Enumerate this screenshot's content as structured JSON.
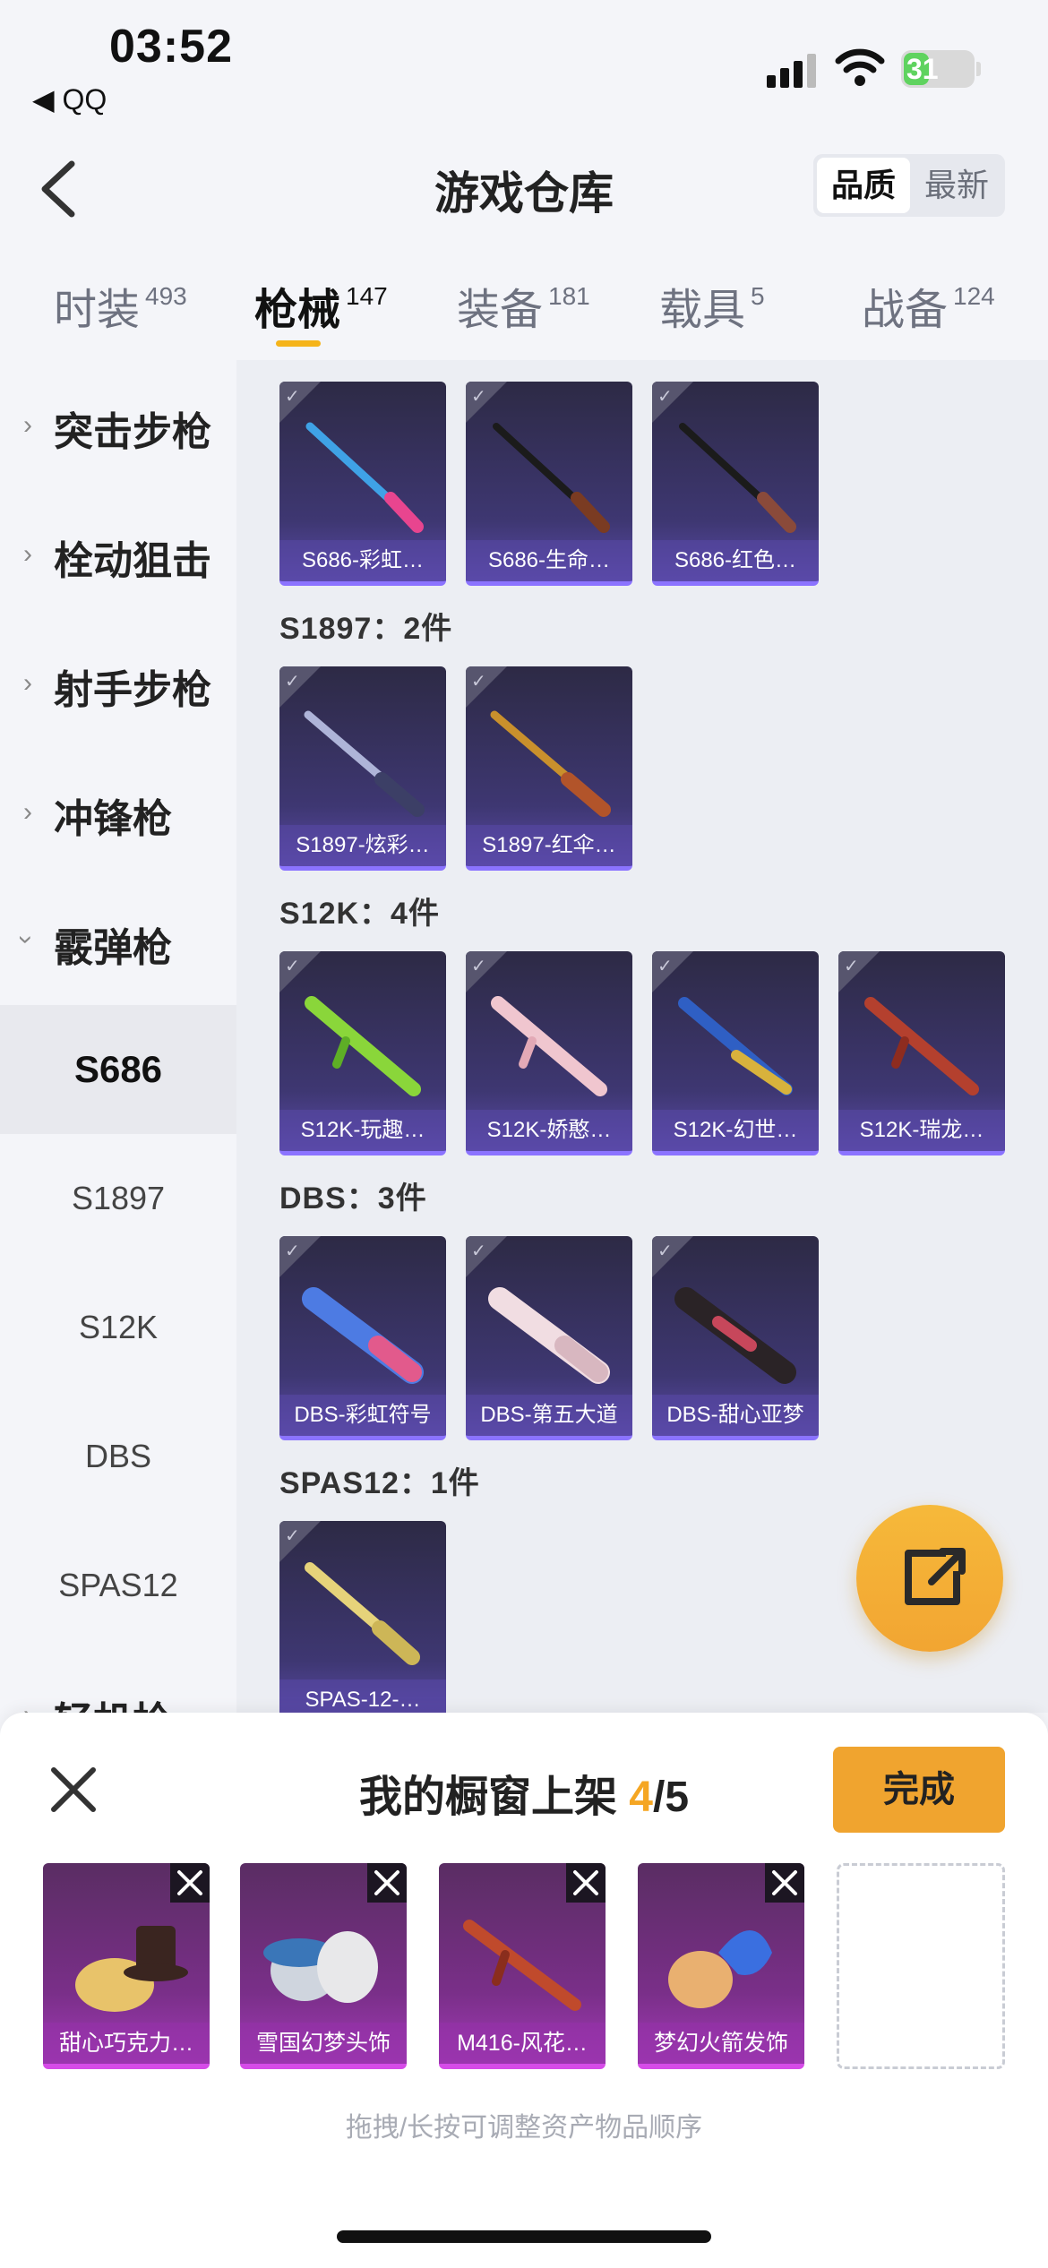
{
  "status_bar": {
    "time": "03:52",
    "back_app": "◀ QQ",
    "battery": "31"
  },
  "header": {
    "title": "游戏仓库",
    "sort_options": [
      "品质",
      "最新"
    ],
    "sort_active": "品质"
  },
  "tabs": [
    {
      "label": "时装",
      "count": "493"
    },
    {
      "label": "枪械",
      "count": "147",
      "active": true
    },
    {
      "label": "装备",
      "count": "181"
    },
    {
      "label": "载具",
      "count": "5"
    },
    {
      "label": "战备",
      "count": "124"
    }
  ],
  "sidebar": {
    "categories": [
      "突击步枪",
      "栓动狙击",
      "射手步枪",
      "冲锋枪",
      "霰弹枪"
    ],
    "subitems": [
      "S686",
      "S1897",
      "S12K",
      "DBS",
      "SPAS12"
    ],
    "active_sub": "S686",
    "partial": "轻机枪"
  },
  "groups": [
    {
      "title": "",
      "items": [
        "S686-彩虹…",
        "S686-生命…",
        "S686-红色…"
      ]
    },
    {
      "title": "S1897：2件",
      "items": [
        "S1897-炫彩…",
        "S1897-红伞…"
      ]
    },
    {
      "title": "S12K：4件",
      "items": [
        "S12K-玩趣…",
        "S12K-娇憨…",
        "S12K-幻世…",
        "S12K-瑞龙…"
      ]
    },
    {
      "title": "DBS：3件",
      "items": [
        "DBS-彩虹符号",
        "DBS-第五大道",
        "DBS-甜心亚梦"
      ]
    },
    {
      "title": "SPAS12：1件",
      "items": [
        "SPAS-12-…"
      ]
    }
  ],
  "sheet": {
    "title_prefix": "我的橱窗上架 ",
    "count": "4",
    "total": "/5",
    "done": "完成",
    "slots": [
      "甜心巧克力…",
      "雪国幻梦头饰",
      "M416-风花…",
      "梦幻火箭发饰"
    ],
    "hint": "拖拽/长按可调整资产物品顺序"
  },
  "colors": {
    "accent": "#f5a623",
    "card_purple": "#3e3772",
    "slot_magenta": "#7a2f89"
  }
}
